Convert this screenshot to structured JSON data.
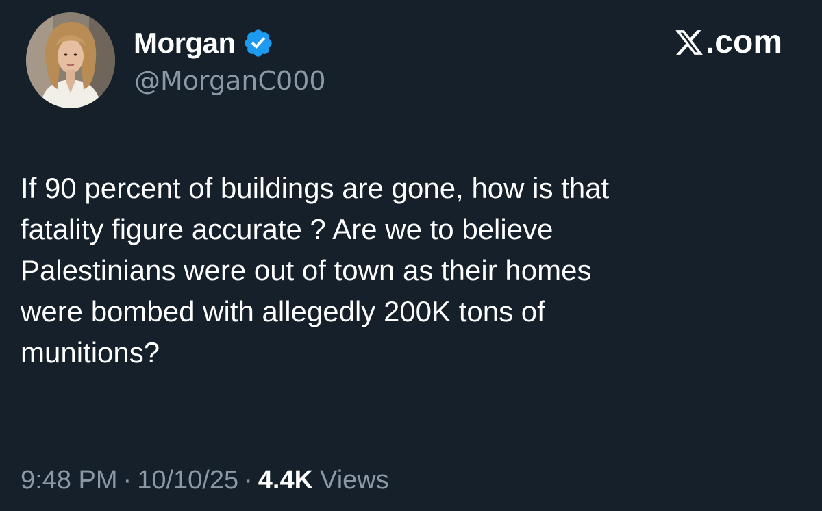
{
  "author": {
    "display_name": "Morgan",
    "handle": "@MorganC000",
    "verified": true,
    "verified_color": "#1d9bf0"
  },
  "brand": {
    "label": ".com",
    "icon": "x-logo-icon"
  },
  "tweet": {
    "lines": [
      "If 90 percent of buildings are gone, how is that",
      "fatality figure accurate ? Are we to believe",
      "Palestinians were out of town as their homes",
      "were bombed with allegedly 200K tons of",
      "munitions?"
    ]
  },
  "meta": {
    "time": "9:48 PM",
    "separator": "·",
    "date": "10/10/25",
    "views_count": "4.4K",
    "views_label": "Views"
  },
  "colors": {
    "background": "#15202b",
    "text_primary": "#ffffff",
    "text_secondary": "#8b98a5"
  }
}
